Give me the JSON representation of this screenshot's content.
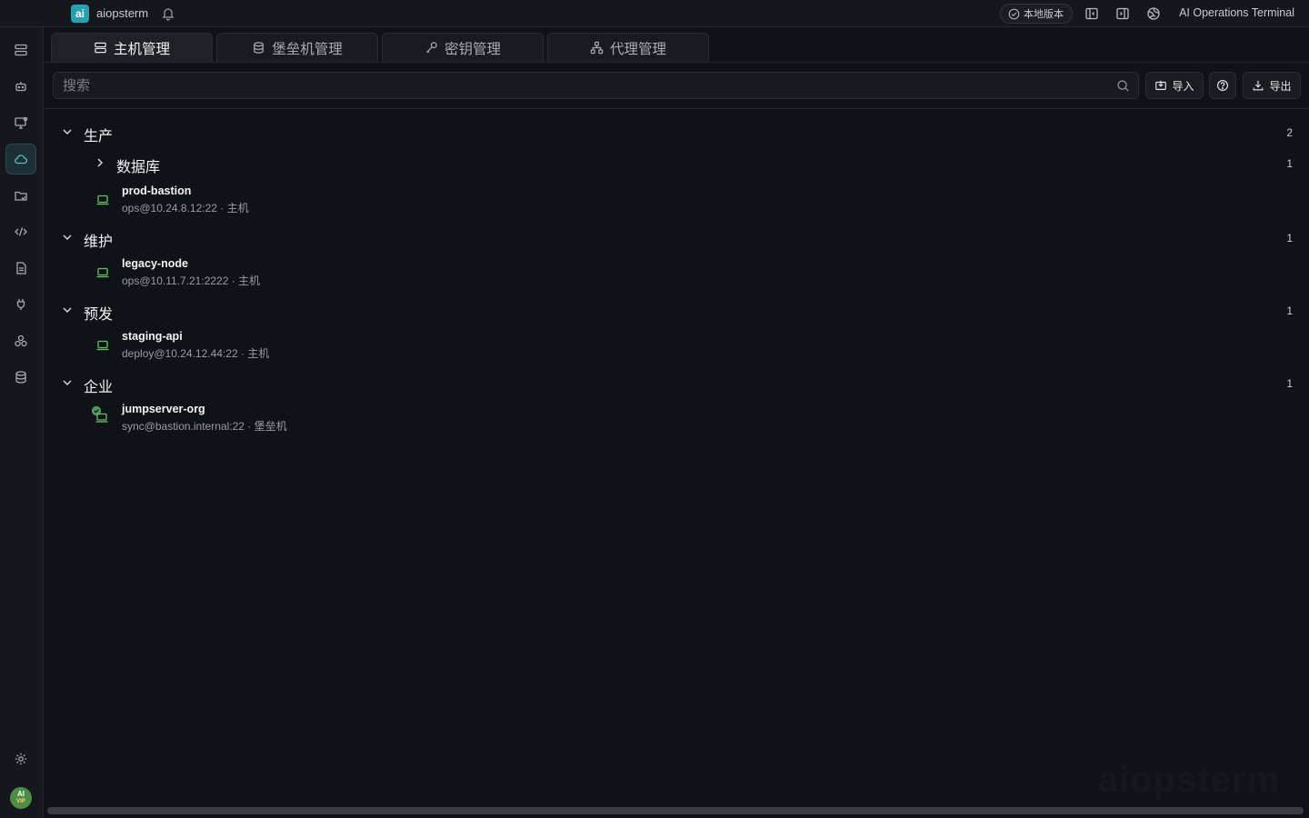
{
  "titlebar": {
    "logo_text": "ai",
    "app_name": "aiopsterm",
    "version_badge": "本地版本",
    "window_title": "AI Operations Terminal"
  },
  "sidebar": {
    "items": [
      {
        "icon": "server-list-icon",
        "active": false
      },
      {
        "icon": "robot-icon",
        "active": false
      },
      {
        "icon": "monitor-icon",
        "active": false
      },
      {
        "icon": "cloud-icon",
        "active": true
      },
      {
        "icon": "folder-sync-icon",
        "active": false
      },
      {
        "icon": "code-icon",
        "active": false
      },
      {
        "icon": "document-icon",
        "active": false
      },
      {
        "icon": "plug-icon",
        "active": false
      },
      {
        "icon": "cluster-icon",
        "active": false
      },
      {
        "icon": "database-icon",
        "active": false
      }
    ],
    "settings_icon": "gear-icon",
    "vip_badge": {
      "top": "AI",
      "bottom": "VIP"
    }
  },
  "tabs": [
    {
      "label": "主机管理",
      "icon": "server-icon",
      "active": true
    },
    {
      "label": "堡垒机管理",
      "icon": "database-icon",
      "active": false
    },
    {
      "label": "密钥管理",
      "icon": "key-icon",
      "active": false
    },
    {
      "label": "代理管理",
      "icon": "network-icon",
      "active": false
    }
  ],
  "toolbar": {
    "search_placeholder": "搜索",
    "import_label": "导入",
    "export_label": "导出"
  },
  "tree": {
    "groups": [
      {
        "name": "生产",
        "count": "2",
        "expanded": true
      },
      {
        "name": "数据库",
        "count": "1",
        "expanded": false,
        "nested": true
      },
      {
        "name": "维护",
        "count": "1",
        "expanded": true
      },
      {
        "name": "预发",
        "count": "1",
        "expanded": true
      },
      {
        "name": "企业",
        "count": "1",
        "expanded": true
      }
    ],
    "hosts": [
      {
        "name": "prod-bastion",
        "detail": "ops@10.24.8.12:22 · 主机",
        "icon": "laptop-icon"
      },
      {
        "name": "legacy-node",
        "detail": "ops@10.11.7.21:2222 · 主机",
        "icon": "laptop-icon"
      },
      {
        "name": "staging-api",
        "detail": "deploy@10.24.12.44:22 · 主机",
        "icon": "laptop-icon"
      },
      {
        "name": "jumpserver-org",
        "detail": "sync@bastion.internal:22 · 堡垒机",
        "icon": "bastion-host-icon"
      }
    ]
  },
  "watermark": "aiopsterm",
  "colors": {
    "background": "#111217",
    "panel": "#16171c",
    "accent_green": "#5fbf6a",
    "active_teal": "#1d2f35"
  }
}
